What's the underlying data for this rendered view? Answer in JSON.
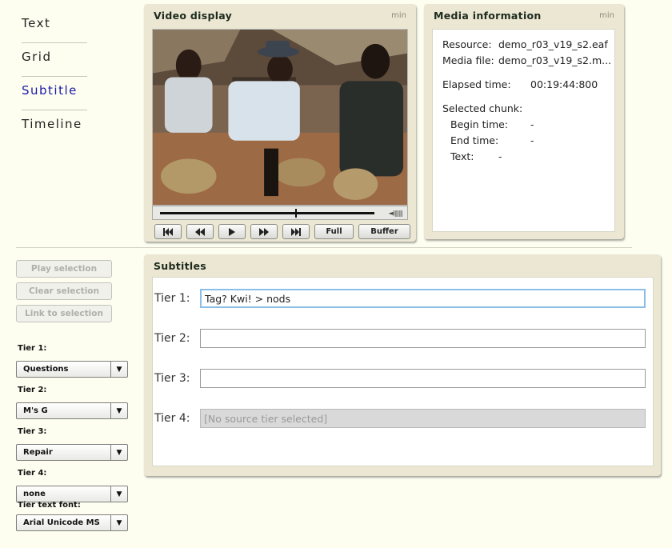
{
  "nav": {
    "items": [
      {
        "label": "Text"
      },
      {
        "label": "Grid"
      },
      {
        "label": "Subtitle"
      },
      {
        "label": "Timeline"
      }
    ],
    "active": "Subtitle"
  },
  "video_panel": {
    "title": "Video display",
    "min_label": "min",
    "progress_fraction": 0.63,
    "controls": {
      "start_icon": "skip-to-start-icon",
      "rewind_icon": "rewind-icon",
      "play_icon": "play-icon",
      "forward_icon": "fast-forward-icon",
      "end_icon": "skip-to-end-icon",
      "full_label": "Full",
      "buffer_label": "Buffer"
    }
  },
  "media_panel": {
    "title": "Media information",
    "min_label": "min",
    "resource_label": "Resource:",
    "resource_value": "demo_r03_v19_s2.eaf",
    "media_file_label": "Media file:",
    "media_file_value": "demo_r03_v19_s2.m...",
    "elapsed_label": "Elapsed time:",
    "elapsed_value": "00:19:44:800",
    "selected_chunk_label": "Selected chunk:",
    "begin_label": "Begin time:",
    "begin_value": "-",
    "end_label": "End time:",
    "end_value": "-",
    "text_label": "Text:",
    "text_value": "-"
  },
  "subtitles_panel": {
    "title": "Subtitles",
    "tiers": [
      {
        "label": "Tier 1:",
        "value": "Tag? Kwi! > nods"
      },
      {
        "label": "Tier 2:",
        "value": ""
      },
      {
        "label": "Tier 3:",
        "value": ""
      },
      {
        "label": "Tier 4:",
        "value": "[No source tier selected]"
      }
    ]
  },
  "left_controls": {
    "play_selection": "Play selection",
    "clear_selection": "Clear selection",
    "link_to_selection": "Link to selection",
    "tier1_label": "Tier 1:",
    "tier1_value": "Questions",
    "tier2_label": "Tier 2:",
    "tier2_value": "M's G",
    "tier3_label": "Tier 3:",
    "tier3_value": "Repair",
    "tier4_label": "Tier 4:",
    "tier4_value": "none",
    "font_label": "Tier text font:",
    "font_value": "Arial Unicode MS"
  },
  "colors": {
    "active_nav": "#1a1aa8",
    "panel_bg": "#ebe7d2",
    "focus_border": "#8cbfe8"
  }
}
